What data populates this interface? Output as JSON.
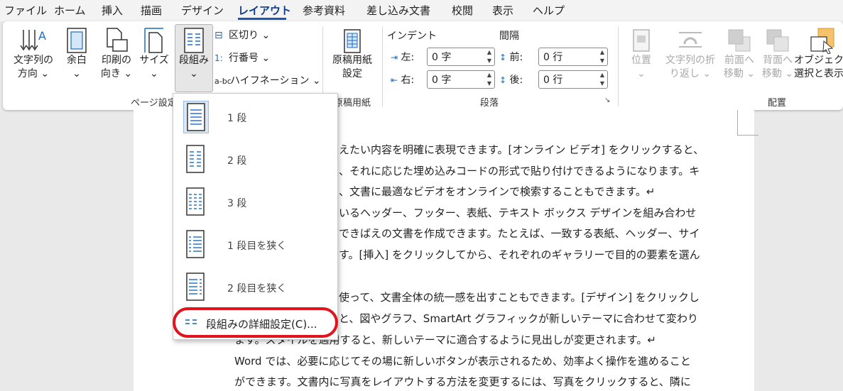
{
  "menubar": {
    "tabs": [
      "ファイル",
      "ホーム",
      "挿入",
      "描画",
      "デザイン",
      "レイアウト",
      "参考資料",
      "差し込み文書",
      "校閲",
      "表示",
      "ヘルプ"
    ],
    "active_tab": "レイアウト"
  },
  "ribbon": {
    "page_setup": {
      "text_direction": [
        "文字列の",
        "方向"
      ],
      "margins": "余白",
      "orientation": [
        "印刷の",
        "向き"
      ],
      "size": "サイズ",
      "columns": "段組み",
      "breaks": "区切り",
      "line_numbers": "行番号",
      "hyphenation": "ハイフネーション",
      "group_label": "ページ設定"
    },
    "manuscript": {
      "button": [
        "原稿用紙",
        "設定"
      ],
      "group_label": "原稿用紙"
    },
    "paragraph": {
      "indent_title": "インデント",
      "spacing_title": "間隔",
      "left_label": "左:",
      "left_value": "0 字",
      "right_label": "右:",
      "right_value": "0 字",
      "before_label": "前:",
      "before_value": "0 行",
      "after_label": "後:",
      "after_value": "0 行",
      "group_label": "段落"
    },
    "arrange": {
      "position": "位置",
      "wrap_text": [
        "文字列の折",
        "り返し"
      ],
      "bring_forward": [
        "前面へ",
        "移動"
      ],
      "send_backward": [
        "背面へ",
        "移動"
      ],
      "selection_pane": [
        "オブジェクトの",
        "選択と表示"
      ],
      "group_label": "配置"
    }
  },
  "columns_menu": {
    "items": [
      "1 段",
      "2 段",
      "3 段",
      "1 段目を狭く",
      "2 段目を狭く"
    ],
    "more": "段組みの詳細設定(C)..."
  },
  "document": {
    "lines": [
      "えたい内容を明確に表現できます。[オンライン ビデオ] をクリックすると、",
      "、それに応じた埋め込みコードの形式で貼り付けできるようになります。キ",
      "、文書に最適なビデオをオンラインで検索することもできます。↵",
      "いるヘッダー、フッター、表紙、テキスト ボックス デザインを組み合わせ",
      "できばえの文書を作成できます。たとえば、一致する表紙、ヘッダー、サイ",
      "す。[挿入] をクリックしてから、それぞれのギャラリーで目的の要素を選ん",
      "",
      "使って、文書全体の統一感を出すこともできます。[デザイン] をクリックし",
      "と、図やグラフ、SmartArt グラフィックが新しいテーマに合わせて変わり",
      "ます。スタイルを適用すると、新しいテーマに適合するように見出しが変更されます。↵",
      "Word では、必要に応じてその場に新しいボタンが表示されるため、効率よく操作を進めること",
      "ができます。文書内に写真をレイアウトする方法を変更するには、写真をクリックすると、隣に"
    ]
  },
  "colors": {
    "accent": "#1a56b4",
    "highlight_ring": "#e0141e"
  }
}
